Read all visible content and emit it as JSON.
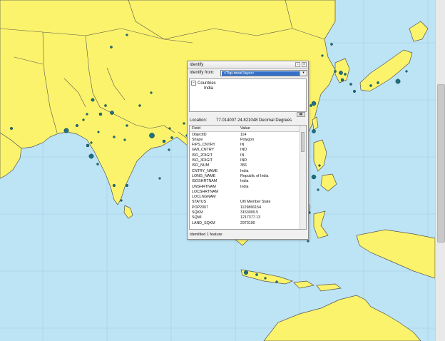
{
  "identify_window": {
    "title": "Identify",
    "pin_symbol": "▫",
    "close_symbol": "×",
    "identify_from_label": "Identify from:",
    "identify_from_value": "<Top-most layer>",
    "dropdown_arrow": "▾",
    "tree": {
      "expander": "−",
      "layer_name": "Countries",
      "feature_name": "India"
    },
    "splitter_symbol": "▮▮",
    "location_label": "Location:",
    "location_value": "77.014007  24.821048 Decimal Degrees",
    "table": {
      "header_field": "Field",
      "header_value": "Value",
      "rows": [
        {
          "field": "ObjectID",
          "value": "114"
        },
        {
          "field": "Shape",
          "value": "Polygon"
        },
        {
          "field": "FIPS_CNTRY",
          "value": "IN"
        },
        {
          "field": "GMI_CNTRY",
          "value": "IND"
        },
        {
          "field": "ISO_2DIGIT",
          "value": "IN"
        },
        {
          "field": "ISO_3DIGIT",
          "value": "IND"
        },
        {
          "field": "ISO_NUM",
          "value": "356"
        },
        {
          "field": "CNTRY_NAME",
          "value": "India"
        },
        {
          "field": "LONG_NAME",
          "value": "Republic of India"
        },
        {
          "field": "ISOSHRTNAM",
          "value": "India"
        },
        {
          "field": "UNSHRTNAM",
          "value": "India"
        },
        {
          "field": "LOCSHRTNAM",
          "value": ""
        },
        {
          "field": "LOCLNGNAM",
          "value": ""
        },
        {
          "field": "STATUS",
          "value": "UN Member State"
        },
        {
          "field": "POP2007",
          "value": "1129866154"
        },
        {
          "field": "SQKM",
          "value": "3153009.5"
        },
        {
          "field": "SQMI",
          "value": "1217377.13"
        },
        {
          "field": "LAND_SQKM",
          "value": "2973190"
        }
      ]
    },
    "status_text": "Identified 1 feature"
  },
  "map": {
    "land_color": "#fbf36b",
    "water_color": "#bde4f4",
    "border_color": "#555555",
    "city_color": "#1f6f80"
  }
}
